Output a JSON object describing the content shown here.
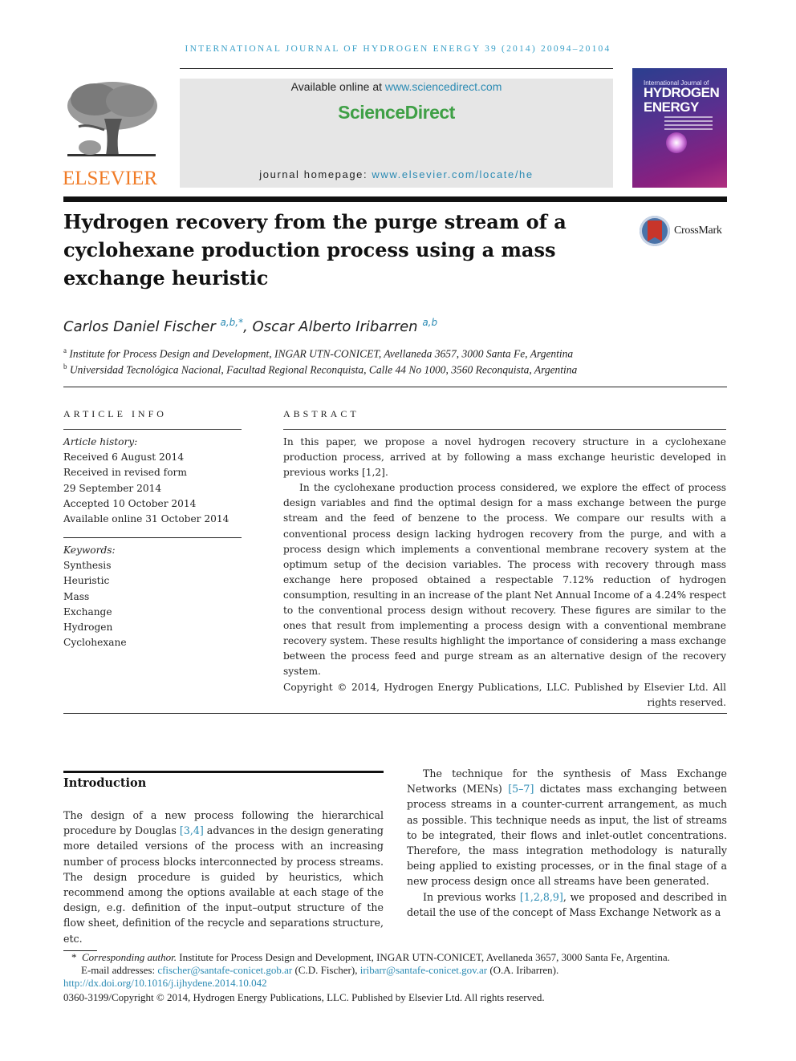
{
  "header": {
    "running_head": "INTERNATIONAL JOURNAL OF HYDROGEN ENERGY 39 (2014) 20094–20104",
    "publisher_logo": "ELSEVIER",
    "available_online_prefix": "Available online at ",
    "available_online_link": "www.sciencedirect.com",
    "platform_logo": "ScienceDirect",
    "homepage_prefix": "journal homepage: ",
    "homepage_link": "www.elsevier.com/locate/he",
    "cover": {
      "line1": "International Journal of",
      "line2": "HYDROGEN",
      "line3": "ENERGY"
    }
  },
  "article": {
    "title": "Hydrogen recovery from the purge stream of a cyclohexane production process using a mass exchange heuristic",
    "crossmark_label": "CrossMark",
    "authors": [
      {
        "name": "Carlos Daniel Fischer",
        "sup": "a,b,*"
      },
      {
        "name": "Oscar Alberto Iribarren",
        "sup": "a,b"
      }
    ],
    "author_separator": ", ",
    "affiliations": [
      {
        "mark": "a",
        "text": "Institute for Process Design and Development, INGAR UTN-CONICET, Avellaneda 3657, 3000 Santa Fe, Argentina"
      },
      {
        "mark": "b",
        "text": "Universidad Tecnológica Nacional, Facultad Regional Reconquista, Calle 44 No 1000, 3560 Reconquista, Argentina"
      }
    ]
  },
  "article_info": {
    "heading": "ARTICLE INFO",
    "history_label": "Article history:",
    "history": [
      "Received 6 August 2014",
      "Received in revised form",
      "29 September 2014",
      "Accepted 10 October 2014",
      "Available online 31 October 2014"
    ],
    "keywords_label": "Keywords:",
    "keywords": [
      "Synthesis",
      "Heuristic",
      "Mass",
      "Exchange",
      "Hydrogen",
      "Cyclohexane"
    ]
  },
  "abstract": {
    "heading": "ABSTRACT",
    "p1": "In this paper, we propose a novel hydrogen recovery structure in a cyclohexane production process, arrived at by following a mass exchange heuristic developed in previous works [1,2].",
    "p2": "In the cyclohexane production process considered, we explore the effect of process design variables and find the optimal design for a mass exchange between the purge stream and the feed of benzene to the process. We compare our results with a conventional process design lacking hydrogen recovery from the purge, and with a process design which implements a conventional membrane recovery system at the optimum setup of the decision variables. The process with recovery through mass exchange here proposed obtained a respectable 7.12% reduction of hydrogen consumption, resulting in an increase of the plant Net Annual Income of a 4.24% respect to the conventional process design without recovery. These figures are similar to the ones that result from implementing a process design with a conventional membrane recovery system. These results highlight the importance of considering a mass exchange between the process feed and purge stream as an alternative design of the recovery system.",
    "copyright": "Copyright © 2014, Hydrogen Energy Publications, LLC. Published by Elsevier Ltd. All rights reserved."
  },
  "introduction": {
    "heading": "Introduction",
    "left_p1_a": "The design of a new process following the hierarchical procedure by Douglas ",
    "left_p1_ref": "[3,4]",
    "left_p1_b": " advances in the design generating more detailed versions of the process with an increasing number of process blocks interconnected by process streams. The design procedure is guided by heuristics, which recommend among the options available at each stage of the design, e.g. definition of the input–output structure of the flow sheet, definition of the recycle and separations structure, etc.",
    "right_p1_a": "The technique for the synthesis of Mass Exchange Networks (MENs) ",
    "right_p1_ref": "[5–7]",
    "right_p1_b": " dictates mass exchanging between process streams in a counter-current arrangement, as much as possible. This technique needs as input, the list of streams to be integrated, their flows and inlet-outlet concentrations. Therefore, the mass integration methodology is naturally being applied to existing processes, or in the final stage of a new process design once all streams have been generated.",
    "right_p2_a": "In previous works ",
    "right_p2_ref": "[1,2,8,9]",
    "right_p2_b": ", we proposed and described in detail the use of the concept of Mass Exchange Network as a"
  },
  "footnotes": {
    "star": "*",
    "corresponding_label": "Corresponding author.",
    "corresponding_text": " Institute for Process Design and Development, INGAR UTN-CONICET, Avellaneda 3657, 3000 Santa Fe, Argentina.",
    "email_label": "E-mail addresses: ",
    "email1": "cfischer@santafe-conicet.gob.ar",
    "email1_name": " (C.D. Fischer), ",
    "email2": "iribarr@santafe-conicet.gov.ar",
    "email2_name": " (O.A. Iribarren).",
    "doi": "http://dx.doi.org/10.1016/j.ijhydene.2014.10.042",
    "issn_copyright": "0360-3199/Copyright © 2014, Hydrogen Energy Publications, LLC. Published by Elsevier Ltd. All rights reserved."
  }
}
